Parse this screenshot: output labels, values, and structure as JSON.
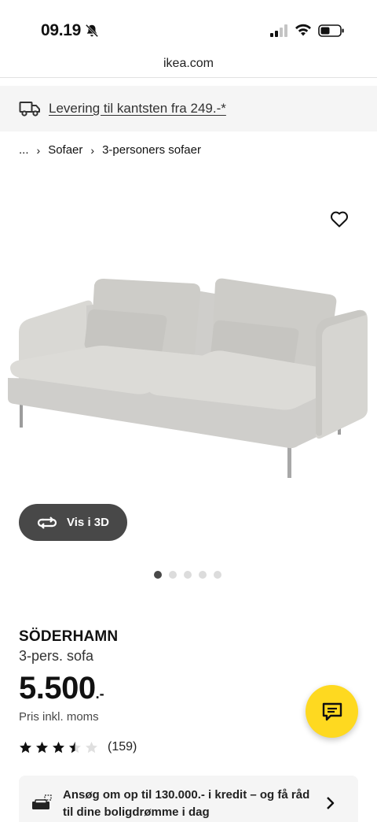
{
  "status_bar": {
    "time": "09.19"
  },
  "browser": {
    "url": "ikea.com"
  },
  "delivery_banner": {
    "text": "Levering til kantsten fra 249.-*"
  },
  "breadcrumb": {
    "ellipsis": "...",
    "items": [
      "Sofaer",
      "3-personers sofaer"
    ]
  },
  "gallery": {
    "view_3d_label": "Vis i 3D",
    "image_count": 5,
    "active_index": 0
  },
  "product": {
    "name": "SÖDERHAMN",
    "description": "3-pers. sofa",
    "price": "5.500",
    "price_suffix": ".-",
    "price_note": "Pris inkl. moms",
    "rating_value": 3.5,
    "rating_max": 5,
    "review_count": "(159)"
  },
  "credit_offer": {
    "text": "Ansøg om op til 130.000.- i kredit – og få råd til dine boligdrømme i dag"
  },
  "icons": {
    "bell": "bell-slash-icon",
    "truck": "truck-icon",
    "heart": "heart-icon",
    "rotate": "rotate-3d-icon",
    "chat": "chat-icon",
    "credit": "sofa-credit-icon",
    "chevron": "chevron-right-icon"
  },
  "colors": {
    "accent_yellow": "#fed920",
    "button_dark": "#484848",
    "banner_gray": "#f5f5f5"
  }
}
